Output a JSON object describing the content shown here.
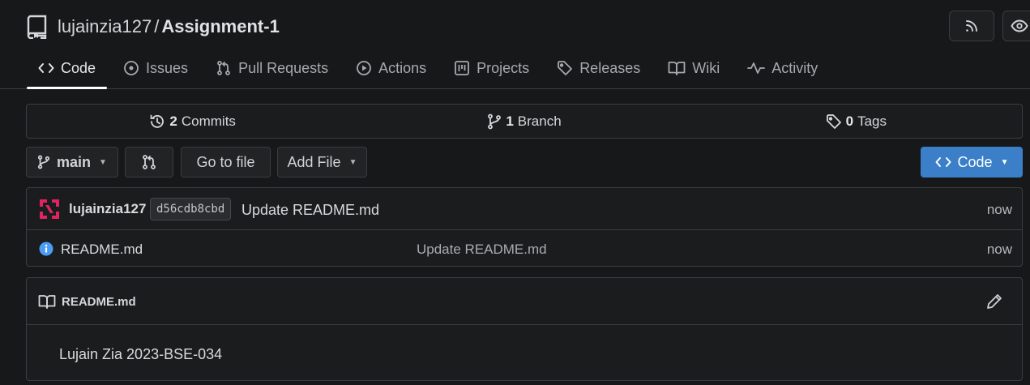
{
  "repo": {
    "owner": "lujainzia127",
    "separator": "/",
    "name": "Assignment-1"
  },
  "tabs": [
    {
      "label": "Code",
      "icon": "code-icon",
      "active": true
    },
    {
      "label": "Issues",
      "icon": "issue-icon"
    },
    {
      "label": "Pull Requests",
      "icon": "pull-request-icon"
    },
    {
      "label": "Actions",
      "icon": "play-icon"
    },
    {
      "label": "Projects",
      "icon": "project-icon"
    },
    {
      "label": "Releases",
      "icon": "tag-icon"
    },
    {
      "label": "Wiki",
      "icon": "book-icon"
    },
    {
      "label": "Activity",
      "icon": "pulse-icon"
    }
  ],
  "stats": {
    "commits_count": "2",
    "commits_label": "Commits",
    "branch_count": "1",
    "branch_label": "Branch",
    "tags_count": "0",
    "tags_label": "Tags"
  },
  "toolbar": {
    "branch": "main",
    "goto_file": "Go to file",
    "add_file": "Add File",
    "code_button": "Code"
  },
  "latest_commit": {
    "user": "lujainzia127",
    "sha": "d56cdb8cbd",
    "message": "Update README.md",
    "time": "now"
  },
  "files": [
    {
      "name": "README.md",
      "message": "Update README.md",
      "time": "now",
      "icon": "info-icon"
    }
  ],
  "readme": {
    "title": "README.md",
    "content": "Lujain Zia 2023-BSE-034"
  },
  "colors": {
    "background": "#171819",
    "border": "#3a3d41",
    "primary": "#3b7fc8",
    "info": "#4b9cf5",
    "avatar": "#e0245e"
  }
}
